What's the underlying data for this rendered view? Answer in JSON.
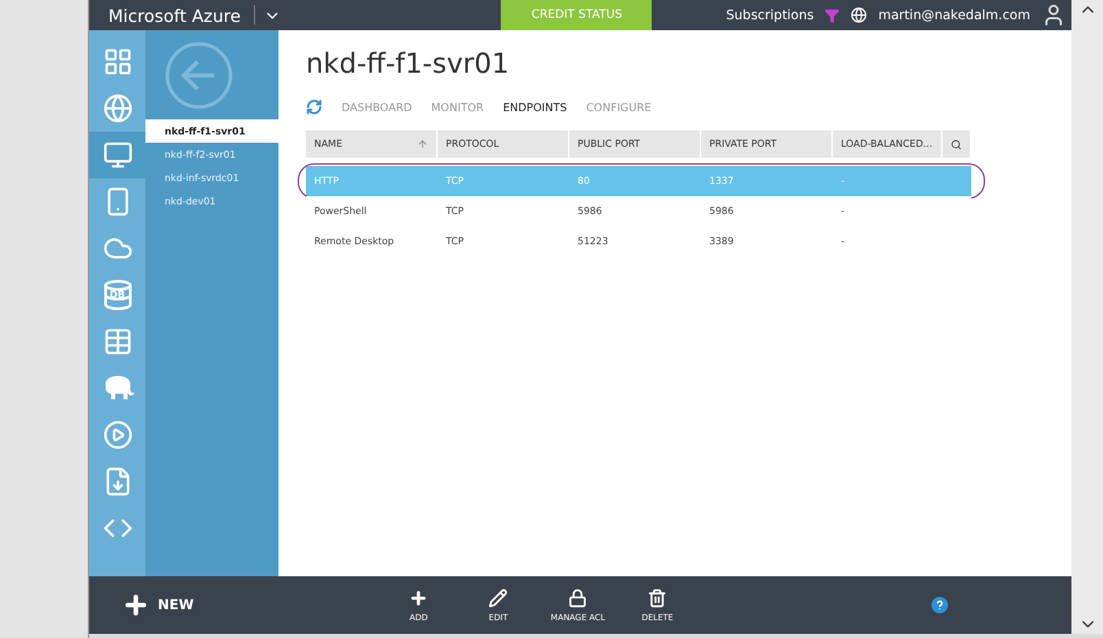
{
  "topbar": {
    "brand": "Microsoft Azure",
    "credit_button": "CREDIT STATUS",
    "subscriptions": "Subscriptions",
    "user": "martin@nakedalm.com"
  },
  "rail": [
    {
      "kind": "grid",
      "selected": false
    },
    {
      "kind": "globe",
      "selected": false
    },
    {
      "kind": "monitor",
      "selected": true
    },
    {
      "kind": "phone",
      "selected": false
    },
    {
      "kind": "cloud",
      "selected": false
    },
    {
      "kind": "db",
      "label": "DB",
      "selected": false
    },
    {
      "kind": "table",
      "selected": false
    },
    {
      "kind": "elephant",
      "selected": false
    },
    {
      "kind": "media",
      "selected": false
    },
    {
      "kind": "import",
      "selected": false
    },
    {
      "kind": "studio",
      "selected": false
    }
  ],
  "nav": [
    {
      "label": "nkd-ff-f1-svr01",
      "selected": true
    },
    {
      "label": "nkd-ff-f2-svr01",
      "selected": false
    },
    {
      "label": "nkd-inf-svrdc01",
      "selected": false
    },
    {
      "label": "nkd-dev01",
      "selected": false
    }
  ],
  "page_title": "nkd-ff-f1-svr01",
  "tabs": [
    {
      "label": "DASHBOARD",
      "selected": false
    },
    {
      "label": "MONITOR",
      "selected": false
    },
    {
      "label": "ENDPOINTS",
      "selected": true
    },
    {
      "label": "CONFIGURE",
      "selected": false
    }
  ],
  "table": {
    "columns": [
      "NAME",
      "PROTOCOL",
      "PUBLIC PORT",
      "PRIVATE PORT",
      "LOAD-BALANCED..."
    ],
    "rows": [
      {
        "cells": [
          "HTTP",
          "TCP",
          "80",
          "1337",
          "-"
        ],
        "selected": true,
        "circled": true
      },
      {
        "cells": [
          "PowerShell",
          "TCP",
          "5986",
          "5986",
          "-"
        ],
        "selected": false,
        "circled": false
      },
      {
        "cells": [
          "Remote Desktop",
          "TCP",
          "51223",
          "3389",
          "-"
        ],
        "selected": false,
        "circled": false
      }
    ]
  },
  "commandbar": {
    "new": "NEW",
    "actions": [
      {
        "kind": "add",
        "label": "ADD"
      },
      {
        "kind": "edit",
        "label": "EDIT"
      },
      {
        "kind": "lock",
        "label": "MANAGE ACL"
      },
      {
        "kind": "delete",
        "label": "DELETE"
      }
    ]
  }
}
